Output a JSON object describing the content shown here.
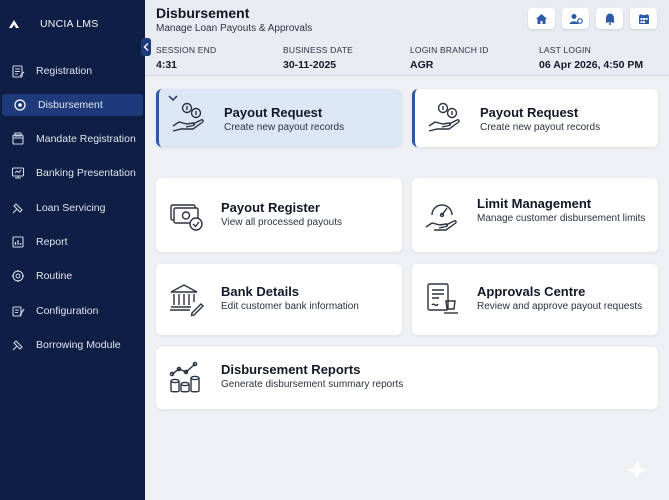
{
  "app": {
    "name": "UNCIA LMS"
  },
  "sidebar": {
    "items": [
      {
        "label": "Registration",
        "icon": "registration-icon"
      },
      {
        "label": "Disbursement",
        "icon": "disbursement-icon",
        "active": true
      },
      {
        "label": "Mandate Registration",
        "icon": "mandate-icon"
      },
      {
        "label": "Banking Presentation",
        "icon": "banking-presentation-icon"
      },
      {
        "label": "Loan Servicing",
        "icon": "loan-servicing-icon"
      },
      {
        "label": "Report",
        "icon": "report-icon"
      },
      {
        "label": "Routine",
        "icon": "routine-icon"
      },
      {
        "label": "Configuration",
        "icon": "configuration-icon"
      },
      {
        "label": "Borrowing Module",
        "icon": "borrowing-icon"
      }
    ]
  },
  "header": {
    "title": "Disbursement",
    "subtitle": "Manage Loan Payouts & Approvals",
    "buttons": [
      "home-icon",
      "user-settings-icon",
      "bell-icon",
      "calendar-icon"
    ],
    "session": [
      {
        "label": "SESSION END",
        "value": "4:31"
      },
      {
        "label": "BUSINESS DATE",
        "value": "30-11-2025"
      },
      {
        "label": "LOGIN BRANCH ID",
        "value": "AGR"
      },
      {
        "label": "LAST LOGIN",
        "value": "06 Apr 2026, 4:50 PM"
      }
    ]
  },
  "cards": [
    {
      "title": "Payout Request",
      "desc": "Create new payout records",
      "icon": "hand-coins-icon",
      "active": true
    },
    {
      "title": "Payout Request",
      "desc": "Create new payout records",
      "icon": "hand-coins-icon"
    },
    {
      "title": "Payout Register",
      "desc": "View all processed payouts",
      "icon": "cash-check-icon"
    },
    {
      "title": "Limit Management",
      "desc": "Manage customer disbursement limits",
      "icon": "gauge-hand-icon"
    },
    {
      "title": "Bank Details",
      "desc": "Edit customer bank information",
      "icon": "bank-edit-icon"
    },
    {
      "title": "Approvals Centre",
      "desc": "Review and approve payout requests",
      "icon": "approval-doc-icon"
    },
    {
      "title": "Disbursement Reports",
      "desc": "Generate disbursement summary reports",
      "icon": "report-chart-icon"
    }
  ],
  "colors": {
    "sidebar": "#0e1e45",
    "active": "#1f3a7a",
    "accent": "#2a5aa8"
  }
}
